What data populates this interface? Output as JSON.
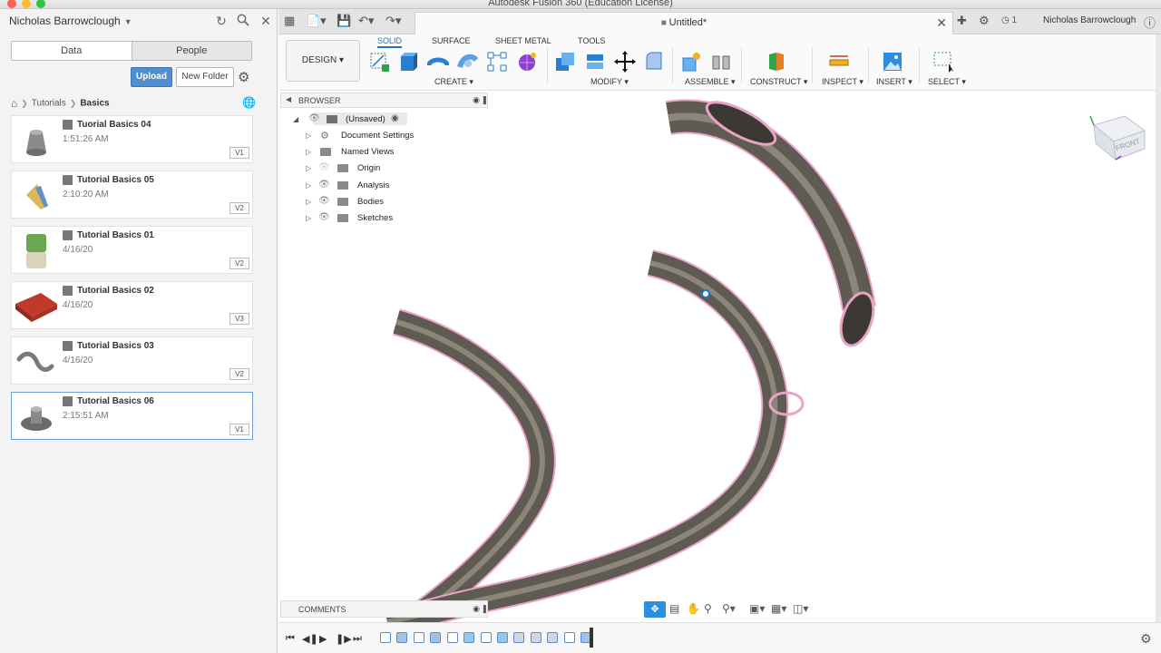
{
  "window": {
    "title": "Autodesk Fusion 360 (Education License)"
  },
  "data_panel": {
    "user_name": "Nicholas Barrowclough",
    "tabs": [
      "Data",
      "People"
    ],
    "upload_label": "Upload",
    "new_folder_label": "New Folder",
    "breadcrumb": [
      "Tutorials",
      "Basics"
    ],
    "files": [
      {
        "name": "Tuorial Basics 04",
        "time": "1:51:26 AM",
        "version": "V1"
      },
      {
        "name": "Tutorial Basics 05",
        "time": "2:10:20 AM",
        "version": "V2"
      },
      {
        "name": "Tutorial Basics 01",
        "time": "4/16/20",
        "version": "V2"
      },
      {
        "name": "Tutorial Basics 02",
        "time": "4/16/20",
        "version": "V3"
      },
      {
        "name": "Tutorial Basics 03",
        "time": "4/16/20",
        "version": "V2"
      },
      {
        "name": "Tutorial Basics 06",
        "time": "2:15:51 AM",
        "version": "V1"
      }
    ]
  },
  "tab_bar": {
    "doc_title": "Untitled*",
    "notification_count": "1",
    "user_name": "Nicholas Barrowclough"
  },
  "ribbon": {
    "workspace": "DESIGN",
    "tabs": [
      "SOLID",
      "SURFACE",
      "SHEET METAL",
      "TOOLS"
    ],
    "groups": [
      "CREATE",
      "MODIFY",
      "ASSEMBLE",
      "CONSTRUCT",
      "INSPECT",
      "INSERT",
      "SELECT"
    ]
  },
  "browser": {
    "title": "BROWSER",
    "root": "(Unsaved)",
    "nodes": [
      "Document Settings",
      "Named Views",
      "Origin",
      "Analysis",
      "Bodies",
      "Sketches"
    ]
  },
  "comments": {
    "title": "COMMENTS"
  },
  "viewcube": {
    "face": "FRONT"
  },
  "colors": {
    "accent": "#1c74c7",
    "upload": "#4f8fcf",
    "tube": "#5f5a52",
    "edge": "#e8a4c6"
  }
}
